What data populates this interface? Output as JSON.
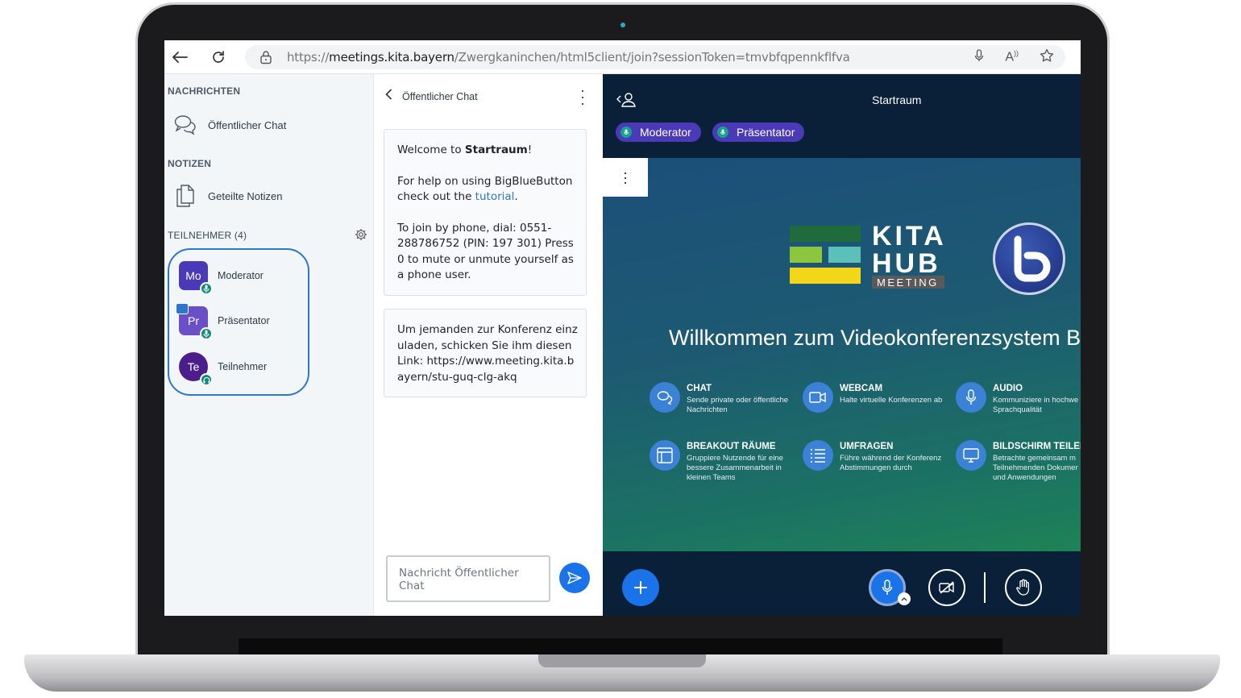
{
  "browser": {
    "url_prefix": "https://",
    "url_host": "meetings.kita.bayern",
    "url_path": "/Zwergkaninchen/html5client/join?sessionToken=tmvbfqpennkflfva"
  },
  "sidebar": {
    "messages_title": "NACHRICHTEN",
    "public_chat_label": "Öffentlicher Chat",
    "notes_title": "NOTIZEN",
    "shared_notes_label": "Geteilte Notizen",
    "participants_title": "TEILNEHMER (4)",
    "users": [
      {
        "initials": "Mo",
        "name": "Moderator",
        "color": "#4a3ab8"
      },
      {
        "initials": "Pr",
        "name": "Präsentator",
        "color": "#6a4fc7"
      },
      {
        "initials": "Te",
        "name": "Teilnehmer",
        "color": "#4b1e8c"
      }
    ]
  },
  "chat": {
    "header": "Öffentlicher Chat",
    "welcome_prefix": "Welcome to ",
    "welcome_room": "Startraum",
    "welcome_suffix": "!",
    "help_text": "For help on using BigBlueButton check out the ",
    "help_link": "tutorial",
    "help_end": ".",
    "phone_text": "To join by phone, dial: 0551-288786752 (PIN: 197 301) Press 0 to mute or unmute yourself as a phone user.",
    "invite_text": "Um jemanden zur Konferenz einzuladen, schicken Sie ihm diesen Link: https://www.meeting.kita.bayern/stu-guq-clg-akq",
    "input_placeholder": "Nachricht Öffentlicher Chat"
  },
  "main": {
    "room_title": "Startraum",
    "pills": [
      "Moderator",
      "Präsentator"
    ],
    "slide": {
      "logo_line1": "KITA",
      "logo_line2": "HUB",
      "logo_line3": "MEETING",
      "welcome": "Willkommen zum Videokonferenzsystem B",
      "features": [
        {
          "title": "CHAT",
          "desc": "Sende private oder öffentliche Nachrichten",
          "icon": "chat-icon"
        },
        {
          "title": "WEBCAM",
          "desc": "Halte virtuelle Konferenzen ab",
          "icon": "webcam-icon"
        },
        {
          "title": "AUDIO",
          "desc": "Kommuniziere in hochwe Sprachqualität",
          "icon": "mic-icon"
        },
        {
          "title": "BREAKOUT RÄUME",
          "desc": "Gruppiere Nutzende für eine bessere Zusammenarbeit in kleinen Teams",
          "icon": "breakout-icon"
        },
        {
          "title": "UMFRAGEN",
          "desc": "Führe während der Konferenz Abstimmungen durch",
          "icon": "poll-icon"
        },
        {
          "title": "BILDSCHIRM TEILEI",
          "desc": "Betrachte gemeinsam m Teilnehmenden Dokumer und Anwendungen",
          "icon": "screen-icon"
        }
      ]
    }
  },
  "colors": {
    "accent": "#1a73e8",
    "sidebar_bg": "#f3f6f9",
    "main_bg": "#0a1f38",
    "kita_dark_green": "#1f6b3b",
    "kita_light_green": "#8cc63f",
    "kita_teal": "#5bc0b8",
    "kita_yellow": "#f2d61a"
  }
}
